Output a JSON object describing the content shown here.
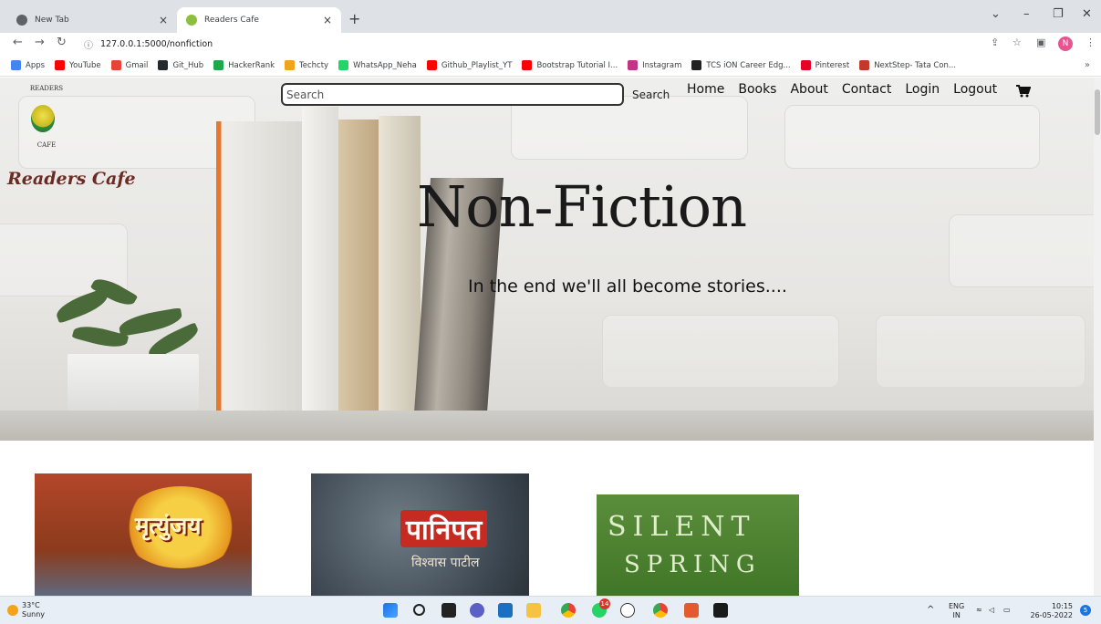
{
  "browser": {
    "tabs": [
      {
        "label": "New Tab",
        "active": false
      },
      {
        "label": "Readers Cafe",
        "active": true
      }
    ],
    "new_tab": "+",
    "url": "127.0.0.1:5000/nonfiction",
    "profile_initial": "N",
    "bookmarks": [
      {
        "label": "Apps",
        "color": "#4285f4"
      },
      {
        "label": "YouTube",
        "color": "#ff0000"
      },
      {
        "label": "Gmail",
        "color": "#ea4335"
      },
      {
        "label": "Git_Hub",
        "color": "#24292e"
      },
      {
        "label": "HackerRank",
        "color": "#1ba94c"
      },
      {
        "label": "Techcty",
        "color": "#f4a21a"
      },
      {
        "label": "WhatsApp_Neha",
        "color": "#25d366"
      },
      {
        "label": "Github_Playlist_YT",
        "color": "#ff0000"
      },
      {
        "label": "Bootstrap Tutorial I...",
        "color": "#ff0000"
      },
      {
        "label": "Instagram",
        "color": "#c13584"
      },
      {
        "label": "TCS iON Career Edg...",
        "color": "#222222"
      },
      {
        "label": "Pinterest",
        "color": "#e60023"
      },
      {
        "label": "NextStep- Tata Con...",
        "color": "#c0392b"
      }
    ],
    "bookmarks_more": "»"
  },
  "site": {
    "logo_top": "READERS",
    "logo_bottom": "CAFE",
    "brand": "Readers Cafe",
    "search": {
      "placeholder": "Search",
      "button": "Search"
    },
    "nav": [
      "Home",
      "Books",
      "About",
      "Contact",
      "Login",
      "Logout"
    ],
    "hero_title": "Non-Fiction",
    "hero_subtitle": "In the end we'll all become stories....",
    "books": [
      {
        "title": "मृत्युंजय"
      },
      {
        "title": "पानिपत",
        "author": "विश्वास पाटील"
      },
      {
        "title_line1": "SILENT",
        "title_line2": "SPRING"
      }
    ]
  },
  "taskbar": {
    "temp": "33°C",
    "condition": "Sunny",
    "lang_top": "ENG",
    "lang_bottom": "IN",
    "time": "10:15",
    "date": "26-05-2022",
    "whatsapp_badge": "14",
    "notif_badge": "5"
  }
}
